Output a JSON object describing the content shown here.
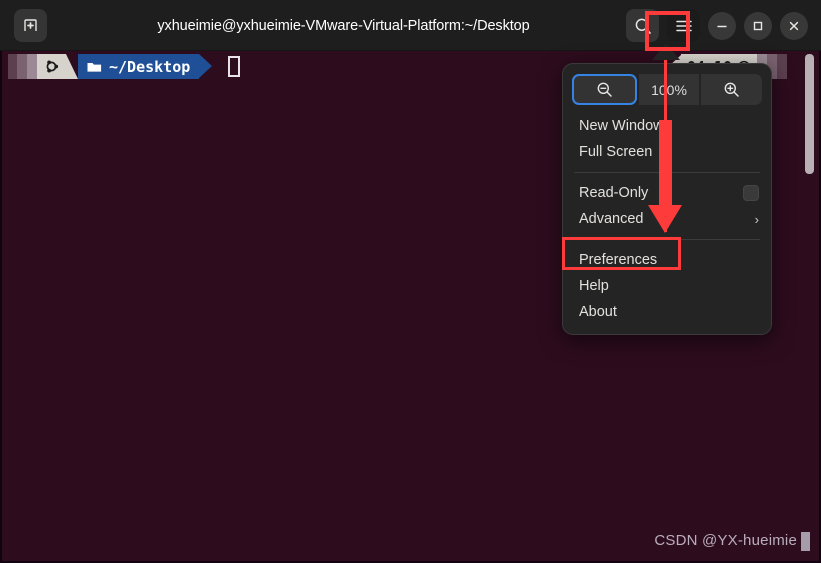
{
  "window": {
    "title": "yxhueimie@yxhueimie-VMware-Virtual-Platform:~/Desktop",
    "background_color": "#2d0c1e",
    "titlebar_color": "#1e1e1e"
  },
  "titlebar": {
    "new_tab_label": "⊞",
    "new_tab_icon": "new-tab-icon",
    "search_icon": "search-icon",
    "menu_icon": "hamburger-menu-icon",
    "minimize_label": "—",
    "maximize_label": "□",
    "close_label": "✕"
  },
  "terminal": {
    "prompt": {
      "logo_glyph": "◈",
      "folder_glyph": "▶",
      "path": "~/Desktop"
    },
    "clock": {
      "icon": "clock-icon",
      "time": "04:10"
    },
    "watermark": "CSDN @YX-hueimie"
  },
  "menu": {
    "zoom": {
      "out_icon": "zoom-out-icon",
      "level": "100%",
      "in_icon": "zoom-in-icon"
    },
    "items": [
      {
        "label": "New Window",
        "type": "action"
      },
      {
        "label": "Full Screen",
        "type": "action"
      },
      {
        "label": "Read-Only",
        "type": "checkbox",
        "checked": false
      },
      {
        "label": "Advanced",
        "type": "submenu",
        "chevron": "›"
      },
      {
        "label": "Preferences",
        "type": "action"
      },
      {
        "label": "Help",
        "type": "action"
      },
      {
        "label": "About",
        "type": "action"
      }
    ]
  },
  "annotations": {
    "highlight_color": "#fe3b3b",
    "menu_button_highlight": "hamburger-menu-button",
    "preferences_highlight": "preferences-menu-item",
    "arrow": "red-arrow-menu-to-preferences"
  }
}
